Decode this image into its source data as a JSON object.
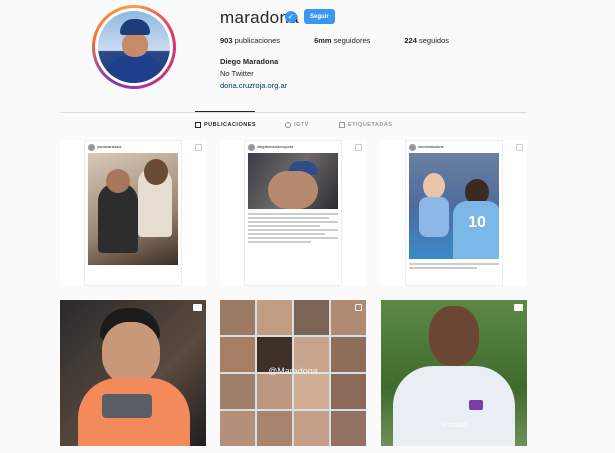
{
  "profile": {
    "username": "maradona",
    "follow_label": "Seguir",
    "stats": [
      {
        "value": "903",
        "label": "publicaciones"
      },
      {
        "value": "6mm",
        "label": "seguidores"
      },
      {
        "value": "224",
        "label": "seguidos"
      }
    ],
    "full_name": "Diego Maradona",
    "bio": "No Twitter",
    "link": "dona.cruzroja.org.ar"
  },
  "tabs": [
    {
      "label": "PUBLICACIONES",
      "icon": "grid-icon",
      "active": true
    },
    {
      "label": "IGTV",
      "icon": "igtv-icon",
      "active": false
    },
    {
      "label": "ETIQUETADAS",
      "icon": "tag-icon",
      "active": false
    }
  ],
  "posts": [
    {
      "kind": "repost",
      "account": "jannamaradona",
      "icon": "multi-post-icon"
    },
    {
      "kind": "repost",
      "account": "dieguitomaradonajunior",
      "icon": "multi-post-icon"
    },
    {
      "kind": "repost",
      "account": "dannamaradona",
      "icon": "multi-post-icon"
    },
    {
      "kind": "video",
      "icon": "video-icon"
    },
    {
      "kind": "collage",
      "caption": "@Maradona",
      "icon": "multi-post-icon"
    },
    {
      "kind": "video",
      "caption": "Ronaldo",
      "icon": "video-icon"
    }
  ],
  "colors": {
    "accent": "#3897f0",
    "background": "#fafafa"
  }
}
